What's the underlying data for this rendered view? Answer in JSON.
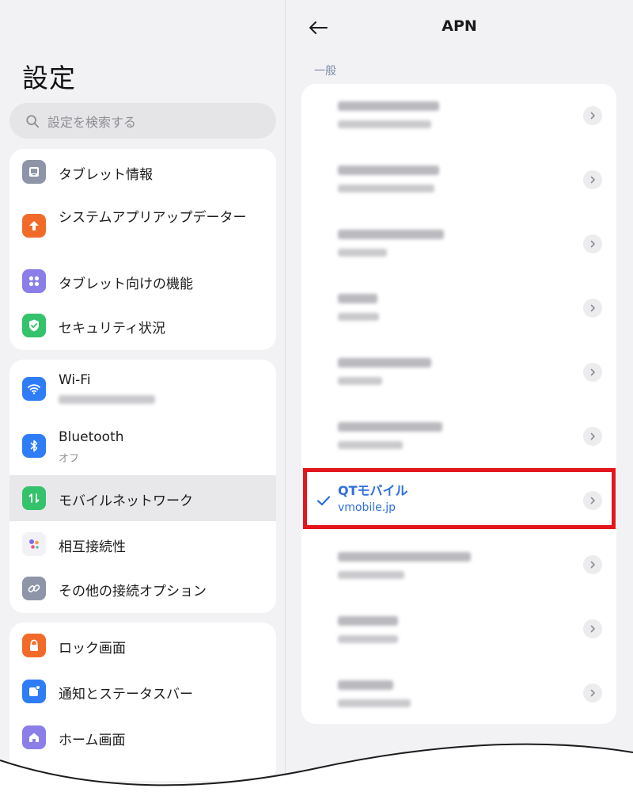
{
  "left": {
    "title": "設定",
    "search_placeholder": "設定を検索する",
    "group1": [
      {
        "label": "タブレット情報",
        "icon": "tablet-icon",
        "color": "#8e95a8"
      },
      {
        "label": "システムアプリアップデーター",
        "icon": "arrow-up-icon",
        "color": "#f26a2a"
      },
      {
        "label": "タブレット向けの機能",
        "icon": "grid-icon",
        "color": "#8b7ee8"
      },
      {
        "label": "セキュリティ状況",
        "icon": "shield-check-icon",
        "color": "#34c26a"
      }
    ],
    "group2": {
      "wifi": {
        "label": "Wi-Fi",
        "icon": "wifi-icon",
        "color": "#2f7df6"
      },
      "bluetooth": {
        "label": "Bluetooth",
        "sub": "オフ",
        "icon": "bluetooth-icon",
        "color": "#2f7df6"
      },
      "mobile": {
        "label": "モバイルネットワーク",
        "icon": "mobile-data-icon",
        "color": "#34c26a"
      },
      "interconnect": {
        "label": "相互接続性",
        "icon": "dots-cluster-icon"
      },
      "other": {
        "label": "その他の接続オプション",
        "icon": "link-icon",
        "color": "#8e95a8"
      }
    },
    "group3": [
      {
        "label": "ロック画面",
        "icon": "lock-icon",
        "color": "#f26a2a"
      },
      {
        "label": "通知とステータスバー",
        "icon": "notification-icon",
        "color": "#2f7df6"
      },
      {
        "label": "ホーム画面",
        "icon": "home-icon",
        "color": "#8b7ee8"
      }
    ]
  },
  "right": {
    "title": "APN",
    "section": "一般",
    "selected": {
      "name": "QTモバイル",
      "apn": "vmobile.jp"
    },
    "accent": "#2f6fde",
    "highlight": "#e3161d"
  }
}
